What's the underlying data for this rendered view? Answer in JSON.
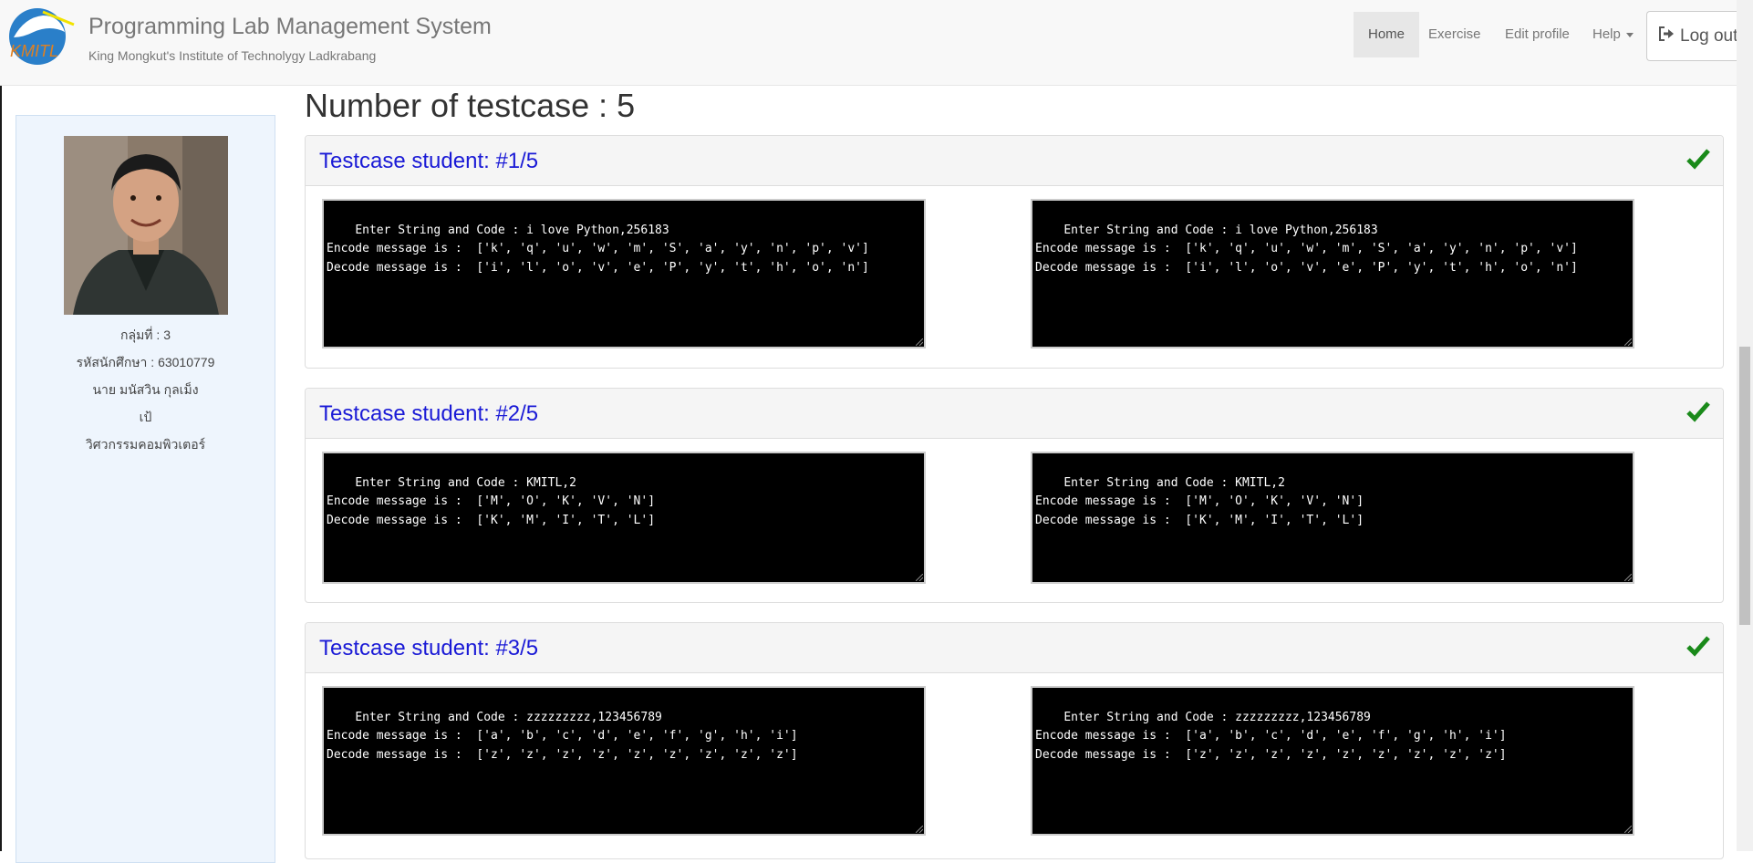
{
  "header": {
    "title": "Programming Lab Management System",
    "subtitle": "King Mongkut's Institute of Technolygy Ladkrabang",
    "logo_text": "KMITL",
    "nav": [
      {
        "label": "Home"
      },
      {
        "label": "Exercise"
      },
      {
        "label": "Edit profile"
      },
      {
        "label": "Help"
      }
    ],
    "logout_label": "Log out"
  },
  "profile": {
    "group": "กลุ่มที่ : 3",
    "student_id": "รหัสนักศึกษา : 63010779",
    "name": "นาย มนัสวิน กุลเม็ง",
    "nickname": "เป้",
    "department": "วิศวกรรมคอมพิวเตอร์"
  },
  "main": {
    "heading": "Number of testcase : 5",
    "testcases": [
      {
        "title": "Testcase student: #1/5",
        "student_output": "Enter String and Code : i love Python,256183\nEncode message is :  ['k', 'q', 'u', 'w', 'm', 'S', 'a', 'y', 'n', 'p', 'v']\nDecode message is :  ['i', 'l', 'o', 'v', 'e', 'P', 'y', 't', 'h', 'o', 'n']",
        "expected_output": "Enter String and Code : i love Python,256183\nEncode message is :  ['k', 'q', 'u', 'w', 'm', 'S', 'a', 'y', 'n', 'p', 'v']\nDecode message is :  ['i', 'l', 'o', 'v', 'e', 'P', 'y', 't', 'h', 'o', 'n']"
      },
      {
        "title": "Testcase student: #2/5",
        "student_output": "Enter String and Code : KMITL,2\nEncode message is :  ['M', 'O', 'K', 'V', 'N']\nDecode message is :  ['K', 'M', 'I', 'T', 'L']",
        "expected_output": "Enter String and Code : KMITL,2\nEncode message is :  ['M', 'O', 'K', 'V', 'N']\nDecode message is :  ['K', 'M', 'I', 'T', 'L']"
      },
      {
        "title": "Testcase student: #3/5",
        "student_output": "Enter String and Code : zzzzzzzzz,123456789\nEncode message is :  ['a', 'b', 'c', 'd', 'e', 'f', 'g', 'h', 'i']\nDecode message is :  ['z', 'z', 'z', 'z', 'z', 'z', 'z', 'z', 'z']",
        "expected_output": "Enter String and Code : zzzzzzzzz,123456789\nEncode message is :  ['a', 'b', 'c', 'd', 'e', 'f', 'g', 'h', 'i']\nDecode message is :  ['z', 'z', 'z', 'z', 'z', 'z', 'z', 'z', 'z']"
      }
    ]
  },
  "colors": {
    "accent_link": "#1a1ad6",
    "pass_check": "#1a8a1a",
    "console_bg": "#000000",
    "sidebar_bg": "#eef5fd"
  },
  "icons": {
    "pass": "check-icon",
    "logout": "logout-icon",
    "help_dropdown": "caret-down-icon"
  }
}
